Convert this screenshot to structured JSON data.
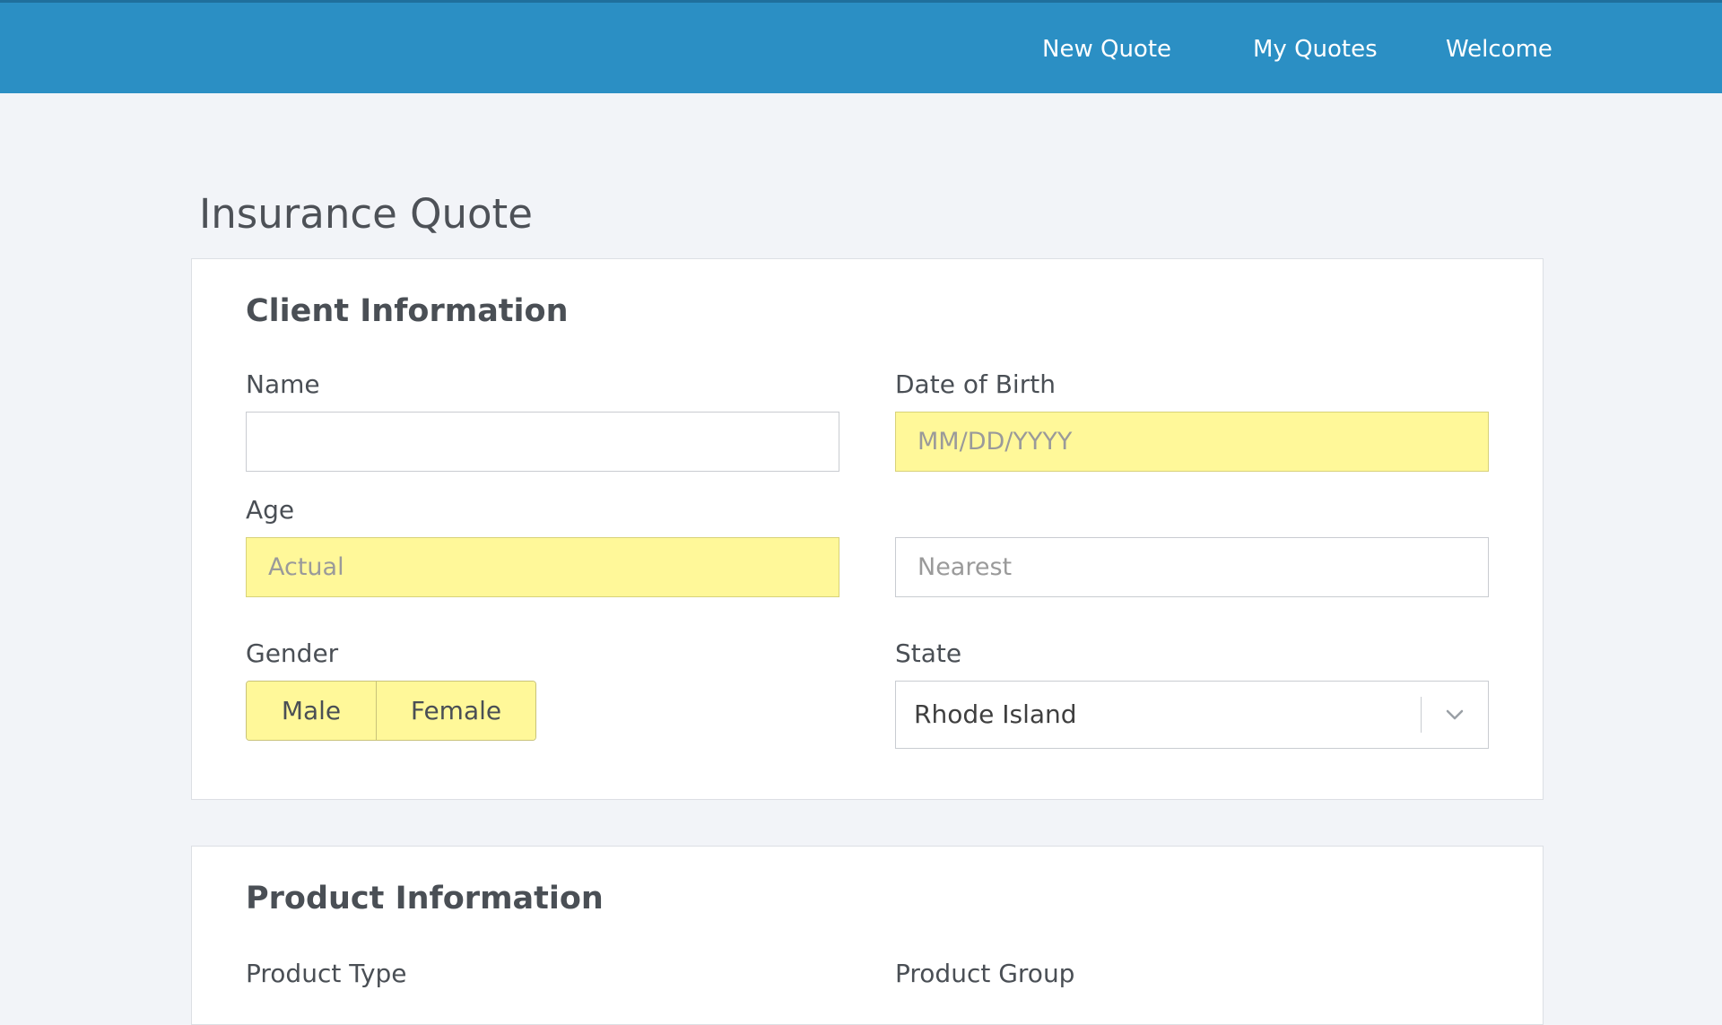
{
  "nav": {
    "items": [
      "New Quote",
      "My Quotes",
      "Welcome"
    ]
  },
  "page": {
    "title": "Insurance Quote"
  },
  "client": {
    "section_title": "Client Information",
    "name_label": "Name",
    "name_value": "",
    "dob_label": "Date of Birth",
    "dob_placeholder": "MM/DD/YYYY",
    "age_label": "Age",
    "age_actual_placeholder": "Actual",
    "age_nearest_placeholder": "Nearest",
    "gender_label": "Gender",
    "gender_options": [
      "Male",
      "Female"
    ],
    "state_label": "State",
    "state_value": "Rhode Island"
  },
  "product": {
    "section_title": "Product Information",
    "type_label": "Product Type",
    "group_label": "Product Group"
  },
  "colors": {
    "header": "#2b8fc4",
    "highlight": "#fff899"
  },
  "icons": {
    "state_dropdown": "chevron-down-icon"
  }
}
